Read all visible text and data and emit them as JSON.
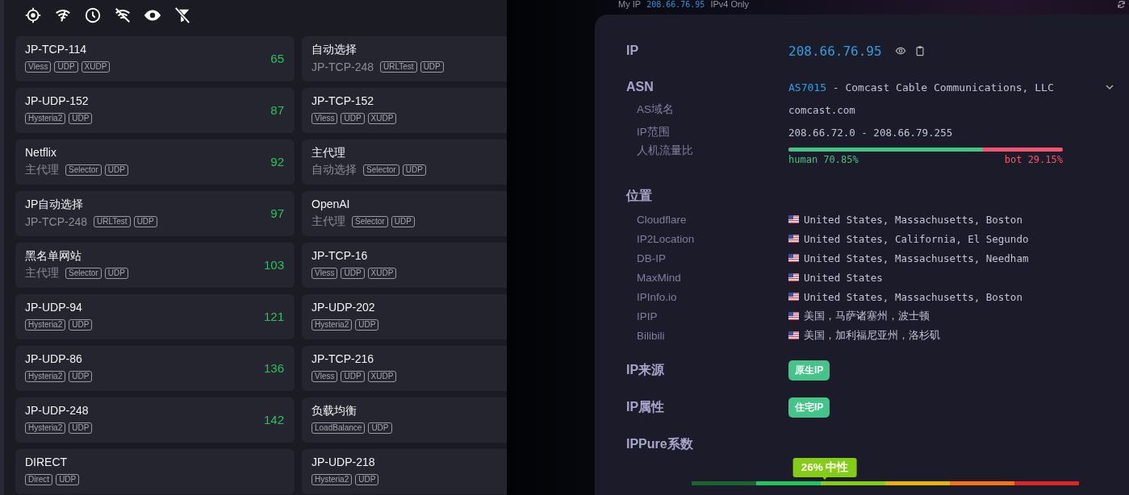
{
  "nodes": [
    {
      "name": "JP-TCP-114",
      "tags": [
        "Vless",
        "UDP",
        "XUDP"
      ],
      "latency": "65"
    },
    {
      "name": "自动选择",
      "via": "JP-TCP-248",
      "tags": [
        "URLTest",
        "UDP"
      ]
    },
    {
      "name": "JP-UDP-152",
      "tags": [
        "Hysteria2",
        "UDP"
      ],
      "latency": "87"
    },
    {
      "name": "JP-TCP-152",
      "tags": [
        "Vless",
        "UDP",
        "XUDP"
      ]
    },
    {
      "name": "Netflix",
      "via": "主代理",
      "tags": [
        "Selector",
        "UDP"
      ],
      "latency": "92"
    },
    {
      "name": "主代理",
      "via": "自动选择",
      "tags": [
        "Selector",
        "UDP"
      ]
    },
    {
      "name": "JP自动选择",
      "via": "JP-TCP-248",
      "tags": [
        "URLTest",
        "UDP"
      ],
      "latency": "97"
    },
    {
      "name": "OpenAI",
      "via": "主代理",
      "tags": [
        "Selector",
        "UDP"
      ]
    },
    {
      "name": "黑名单网站",
      "via": "主代理",
      "tags": [
        "Selector",
        "UDP"
      ],
      "latency": "103"
    },
    {
      "name": "JP-TCP-16",
      "tags": [
        "Vless",
        "UDP",
        "XUDP"
      ]
    },
    {
      "name": "JP-UDP-94",
      "tags": [
        "Hysteria2",
        "UDP"
      ],
      "latency": "121"
    },
    {
      "name": "JP-UDP-202",
      "tags": [
        "Hysteria2",
        "UDP"
      ]
    },
    {
      "name": "JP-UDP-86",
      "tags": [
        "Hysteria2",
        "UDP"
      ],
      "latency": "136"
    },
    {
      "name": "JP-TCP-216",
      "tags": [
        "Vless",
        "UDP",
        "XUDP"
      ]
    },
    {
      "name": "JP-UDP-248",
      "tags": [
        "Hysteria2",
        "UDP"
      ],
      "latency": "142"
    },
    {
      "name": "负载均衡",
      "tags": [
        "LoadBalance",
        "UDP"
      ]
    },
    {
      "name": "DIRECT",
      "tags": [
        "Direct",
        "UDP"
      ]
    },
    {
      "name": "JP-UDP-218",
      "tags": [
        "Hysteria2",
        "UDP"
      ]
    }
  ],
  "my_ip_bar": {
    "label": "My IP",
    "ip": "208.66.76.95",
    "mode": "IPv4 Only"
  },
  "ip_info": {
    "ip": {
      "label": "IP",
      "value": "208.66.76.95"
    },
    "asn": {
      "label": "ASN",
      "number": "AS7015",
      "name": " - Comcast Cable Communications, LLC",
      "details": [
        {
          "label": "AS域名",
          "value": "comcast.com"
        },
        {
          "label": "IP范围",
          "value": "208.66.72.0 - 208.66.79.255"
        }
      ]
    },
    "traffic": {
      "label": "人机流量比",
      "level": 0.7085,
      "human": "human 70.85%",
      "bot": "bot 29.15%"
    },
    "location": {
      "label": "位置",
      "sources": [
        {
          "name": "Cloudflare",
          "value": "United States, Massachusetts, Boston"
        },
        {
          "name": "IP2Location",
          "value": "United States, California, El Segundo"
        },
        {
          "name": "DB-IP",
          "value": "United States, Massachusetts, Needham"
        },
        {
          "name": "MaxMind",
          "value": "United States"
        },
        {
          "name": "IPInfo.io",
          "value": "United States, Massachusetts, Boston"
        },
        {
          "name": "IPIP",
          "value": "美国，马萨诸塞州，波士顿"
        },
        {
          "name": "Bilibili",
          "value": "美国，加利福尼亚州，洛杉矶"
        }
      ]
    },
    "source": {
      "label": "IP来源",
      "badge": "原生IP"
    },
    "attribute": {
      "label": "IP属性",
      "badge": "住宅IP"
    },
    "ippure": {
      "label": "IPPure系数",
      "marker": "26% 中性",
      "level": 0.344
    }
  }
}
